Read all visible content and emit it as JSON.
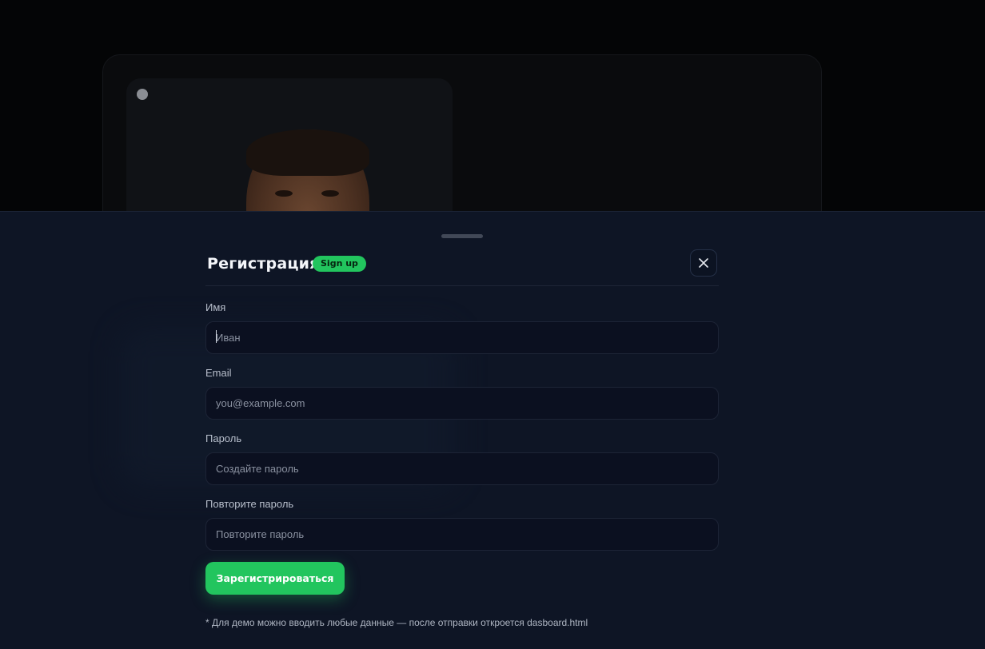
{
  "modal": {
    "title": "Регистрация",
    "badge": "Sign up",
    "close_icon": "close-icon"
  },
  "form": {
    "name": {
      "label": "Имя",
      "placeholder": "Иван",
      "value": ""
    },
    "email": {
      "label": "Email",
      "placeholder": "you@example.com",
      "value": ""
    },
    "password": {
      "label": "Пароль",
      "placeholder": "Создайте пароль",
      "value": ""
    },
    "password_repeat": {
      "label": "Повторите пароль",
      "placeholder": "Повторите пароль",
      "value": ""
    },
    "submit_label": "Зарегистрироваться"
  },
  "footnote": "* Для демо можно вводить любые данные — после отправки откроется dasboard.html",
  "colors": {
    "accent": "#22c55e",
    "sheet_bg": "#0e1525",
    "input_bg": "#0b1020"
  }
}
